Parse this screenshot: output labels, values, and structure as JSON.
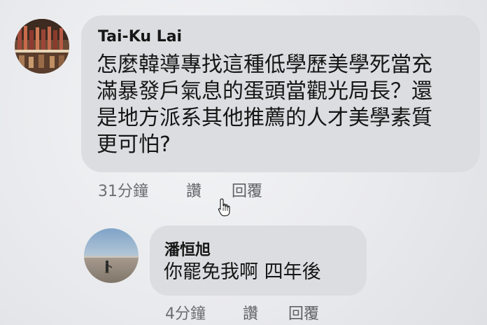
{
  "comments": [
    {
      "author": "Tai-Ku Lai",
      "text_lines": [
        "怎麼韓導專找這種低學歷美學死當充",
        "滿暴發戶氣息的蛋頭當觀光局長？還",
        "是地方派系其他推薦的人才美學素質",
        "更可怕?"
      ],
      "time": "31分鐘",
      "like_label": "讚",
      "reply_label": "回覆"
    },
    {
      "author": "潘恒旭",
      "text": "你罷免我啊 四年後",
      "time": "4分鐘",
      "like_label": "讚",
      "reply_label": "回覆"
    }
  ],
  "colors": {
    "bubble": "#dcdde0",
    "background": "#ecedef",
    "meta_text": "#6d6e72"
  },
  "icons": {
    "cursor": "hand-pointer-icon"
  }
}
